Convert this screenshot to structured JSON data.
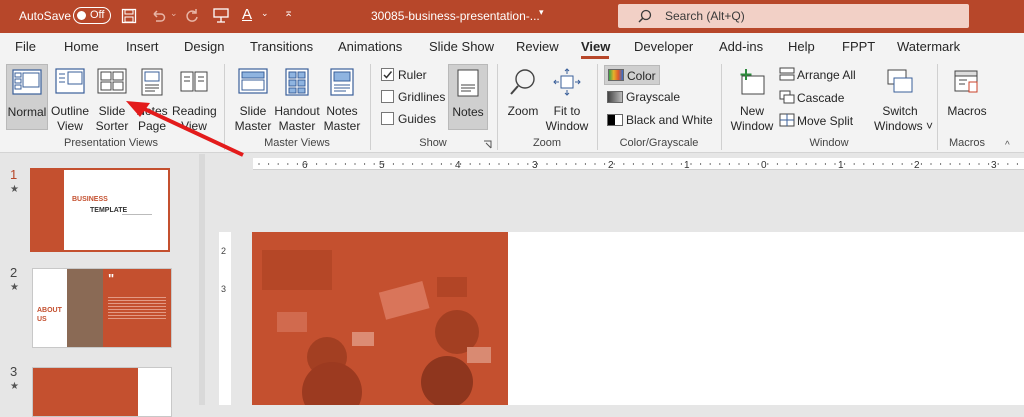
{
  "titlebar": {
    "autosave_label": "AutoSave",
    "autosave_state": "Off",
    "file_name": "30085-business-presentation-...",
    "search_placeholder": "Search (Alt+Q)"
  },
  "tabs": [
    "File",
    "Home",
    "Insert",
    "Design",
    "Transitions",
    "Animations",
    "Slide Show",
    "Review",
    "View",
    "Developer",
    "Add-ins",
    "Help",
    "FPPT",
    "Watermark"
  ],
  "active_tab": "View",
  "ribbon": {
    "presentation_views": {
      "label": "Presentation Views",
      "normal": "Normal",
      "outline_1": "Outline",
      "outline_2": "View",
      "sorter_1": "Slide",
      "sorter_2": "Sorter",
      "notes_page_1": "Notes",
      "notes_page_2": "Page",
      "reading_1": "Reading",
      "reading_2": "View"
    },
    "master_views": {
      "label": "Master Views",
      "slide_1": "Slide",
      "slide_2": "Master",
      "handout_1": "Handout",
      "handout_2": "Master",
      "notes_1": "Notes",
      "notes_2": "Master"
    },
    "show": {
      "label": "Show",
      "ruler": "Ruler",
      "gridlines": "Gridlines",
      "guides": "Guides",
      "notes": "Notes"
    },
    "zoom": {
      "label": "Zoom",
      "zoom": "Zoom",
      "fit_1": "Fit to",
      "fit_2": "Window"
    },
    "color": {
      "label": "Color/Grayscale",
      "color": "Color",
      "grayscale": "Grayscale",
      "bw": "Black and White"
    },
    "window": {
      "label": "Window",
      "new_1": "New",
      "new_2": "Window",
      "arrange": "Arrange All",
      "cascade": "Cascade",
      "move_split": "Move Split",
      "switch_1": "Switch",
      "switch_2": "Windows ˅"
    },
    "macros": {
      "label": "Macros",
      "macros": "Macros"
    }
  },
  "ruler_numbers": [
    "6",
    "5",
    "4",
    "3",
    "2",
    "1",
    "0",
    "1",
    "2",
    "3"
  ],
  "vruler_numbers": [
    "2",
    "3"
  ],
  "slides": [
    {
      "num": "1",
      "star": "★",
      "title_1": "BUSINESS",
      "title_2": "TEMPLATE"
    },
    {
      "num": "2",
      "star": "★",
      "title_1": "ABOUT",
      "title_2": "US",
      "quote": "\""
    },
    {
      "num": "3",
      "star": "★"
    }
  ],
  "colors": {
    "accent": "#b7472a",
    "slide_orange": "#c4502f"
  }
}
